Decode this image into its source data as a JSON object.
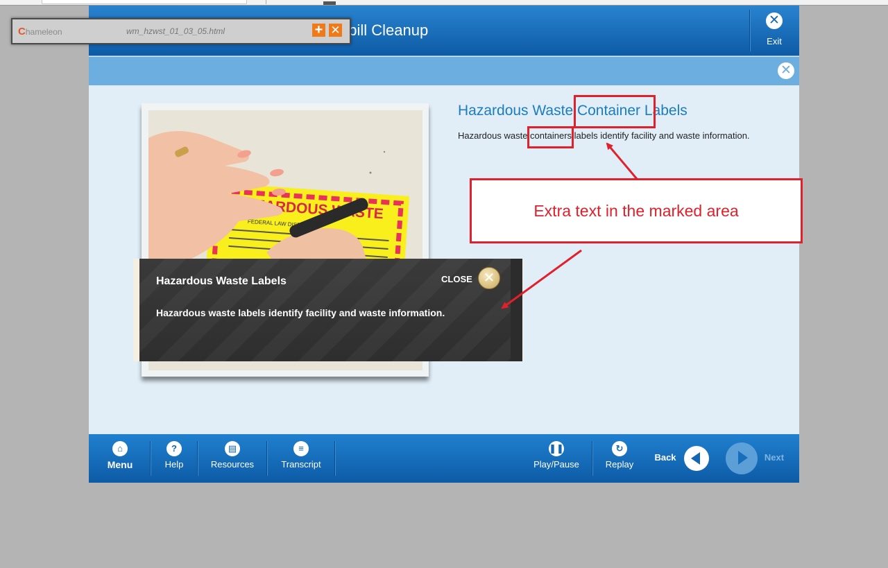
{
  "course": {
    "title": "s Waste & Spill Cleanup",
    "exit_label": "Exit"
  },
  "content": {
    "heading": "Hazardous Waste Container Labels",
    "text": "Hazardous waste containers labels identify facility and waste information."
  },
  "popup": {
    "title": "Hazardous Waste Labels",
    "close_label": "CLOSE",
    "body": "Hazardous waste labels identify facility and waste information."
  },
  "photo": {
    "label_heading": "HAZARDOUS WASTE",
    "label_line": "FEDERAL LAW  DISPOSAL"
  },
  "footer": {
    "menu": "Menu",
    "help": "Help",
    "resources": "Resources",
    "transcript": "Transcript",
    "play_pause": "Play/Pause",
    "replay": "Replay",
    "back": "Back",
    "next": "Next"
  },
  "chameleon": {
    "logo_initial": "C",
    "logo_rest": "hameleon",
    "file_name": "wm_hzwst_01_03_05.html"
  },
  "annotation": {
    "note": "Extra text in the marked area",
    "color": "#e0202a"
  },
  "colors": {
    "header_blue": "#0d5ba6",
    "subbar_blue": "#6caee0",
    "heading_blue": "#1b7cbf",
    "content_bg": "#e1eef8"
  }
}
